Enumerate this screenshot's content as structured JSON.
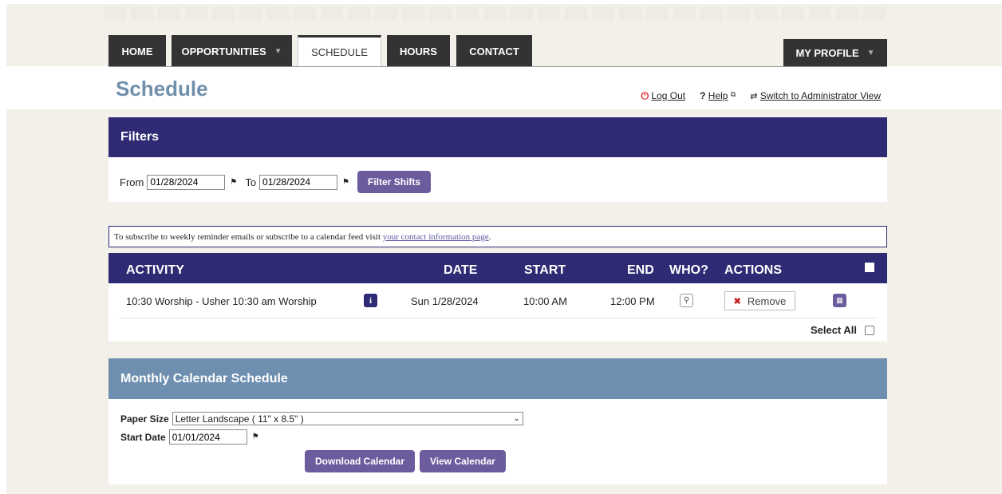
{
  "nav": {
    "items": [
      {
        "label": "HOME"
      },
      {
        "label": "OPPORTUNITIES",
        "caret": "▼"
      },
      {
        "label": "SCHEDULE"
      },
      {
        "label": "HOURS"
      },
      {
        "label": "CONTACT"
      }
    ],
    "profile": {
      "label": "MY PROFILE",
      "caret": "▼"
    }
  },
  "page": {
    "title": "Schedule"
  },
  "top_links": {
    "logout": "Log Out",
    "help": "Help",
    "switch": "Switch to Administrator View"
  },
  "filters": {
    "title": "Filters",
    "from_label": "From",
    "from_value": "01/28/2024",
    "to_label": "To",
    "to_value": "01/28/2024",
    "button": "Filter Shifts"
  },
  "notice": {
    "text": "To subscribe to weekly reminder emails or subscribe to a calendar feed visit ",
    "link": "your contact information page",
    "suffix": "."
  },
  "table": {
    "headers": {
      "activity": "ACTIVITY",
      "date": "DATE",
      "start": "START",
      "end": "END",
      "who": "WHO?",
      "actions": "ACTIONS"
    },
    "rows": [
      {
        "activity": "10:30 Worship - Usher 10:30 am Worship",
        "date": "Sun 1/28/2024",
        "start": "10:00 AM",
        "end": "12:00 PM",
        "remove": "Remove"
      }
    ],
    "select_all": "Select All"
  },
  "calendar": {
    "title": "Monthly Calendar Schedule",
    "paper_label": "Paper Size",
    "paper_value": "Letter Landscape ( 11\" x 8.5\" )",
    "start_label": "Start Date",
    "start_value": "01/01/2024",
    "download": "Download Calendar",
    "view": "View Calendar"
  },
  "colors": {
    "nav": "#333333",
    "header_navy": "#2e2a73",
    "button_purple": "#6c5c9e",
    "calendar_blue": "#6f8fb0",
    "title_blue": "#6f8fab"
  }
}
